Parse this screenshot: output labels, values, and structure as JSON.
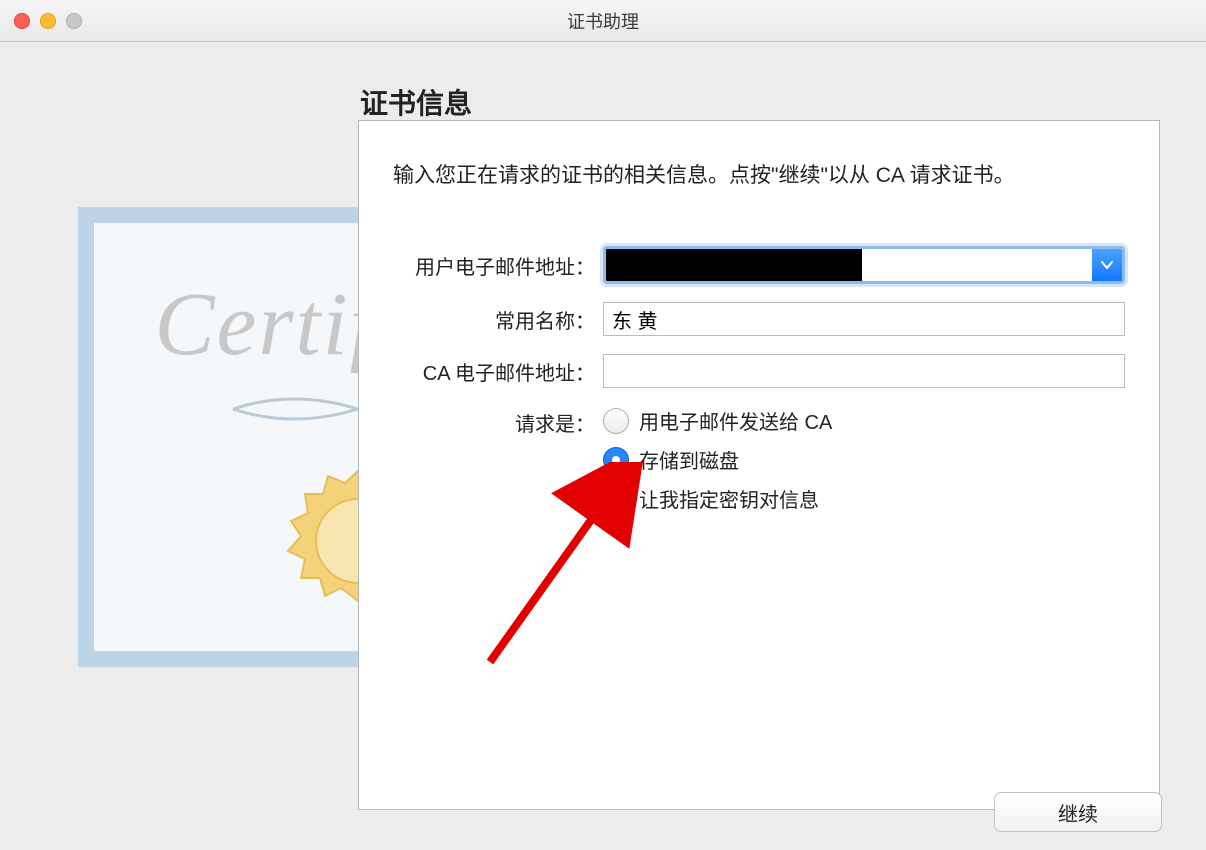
{
  "window": {
    "title": "证书助理"
  },
  "panel": {
    "heading": "证书信息",
    "intro": "输入您正在请求的证书的相关信息。点按\"继续\"以从 CA 请求证书。"
  },
  "certificate_watermark": "Certificate",
  "form": {
    "email_label": "用户电子邮件地址：",
    "email_value": "",
    "common_name_label": "常用名称：",
    "common_name_value": "东 黄",
    "ca_email_label": "CA 电子邮件地址：",
    "ca_email_value": "",
    "request_type_label": "请求是：",
    "options": {
      "send_email": "用电子邮件发送给 CA",
      "save_disk": "存储到磁盘",
      "specify_keypair": "让我指定密钥对信息"
    },
    "selected_option": "save_disk",
    "specify_keypair_checked": false
  },
  "buttons": {
    "continue": "继续"
  },
  "colors": {
    "accent": "#2a86ff",
    "focus_ring": "#8fbcef"
  }
}
